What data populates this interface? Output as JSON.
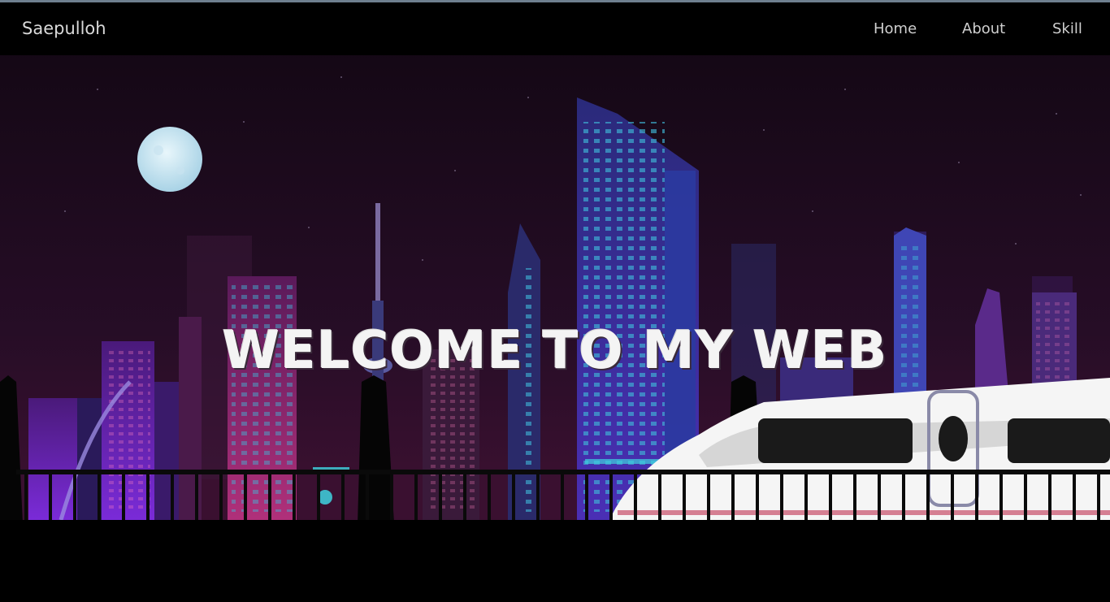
{
  "navbar": {
    "brand": "Saepulloh",
    "links": [
      {
        "label": "Home"
      },
      {
        "label": "About"
      },
      {
        "label": "Skill"
      }
    ]
  },
  "hero": {
    "title": "WELCOME TO MY WEB"
  },
  "colors": {
    "sky": "#1b0a1e",
    "navbar": "#000000",
    "neon_cyan": "#3fd3e0",
    "neon_purple": "#7a2bd8",
    "train_white": "#f5f5f5"
  }
}
